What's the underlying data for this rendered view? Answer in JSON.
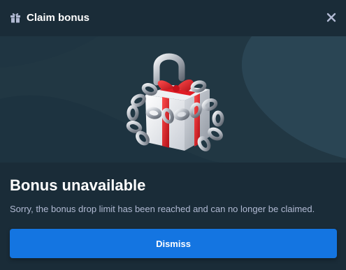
{
  "header": {
    "icon": "gift-icon",
    "title": "Claim bonus",
    "close_icon": "close-icon"
  },
  "hero": {
    "illustration": "chained-gift-padlock"
  },
  "content": {
    "title": "Bonus unavailable",
    "description": "Sorry, the bonus drop limit has been reached and can no longer be claimed."
  },
  "actions": {
    "dismiss_label": "Dismiss"
  },
  "colors": {
    "background": "#1a2c38",
    "hero_background": "#213743",
    "accent": "#1475e1",
    "text_primary": "#ffffff",
    "text_secondary": "#b1bad3",
    "ribbon": "#e01b24"
  }
}
